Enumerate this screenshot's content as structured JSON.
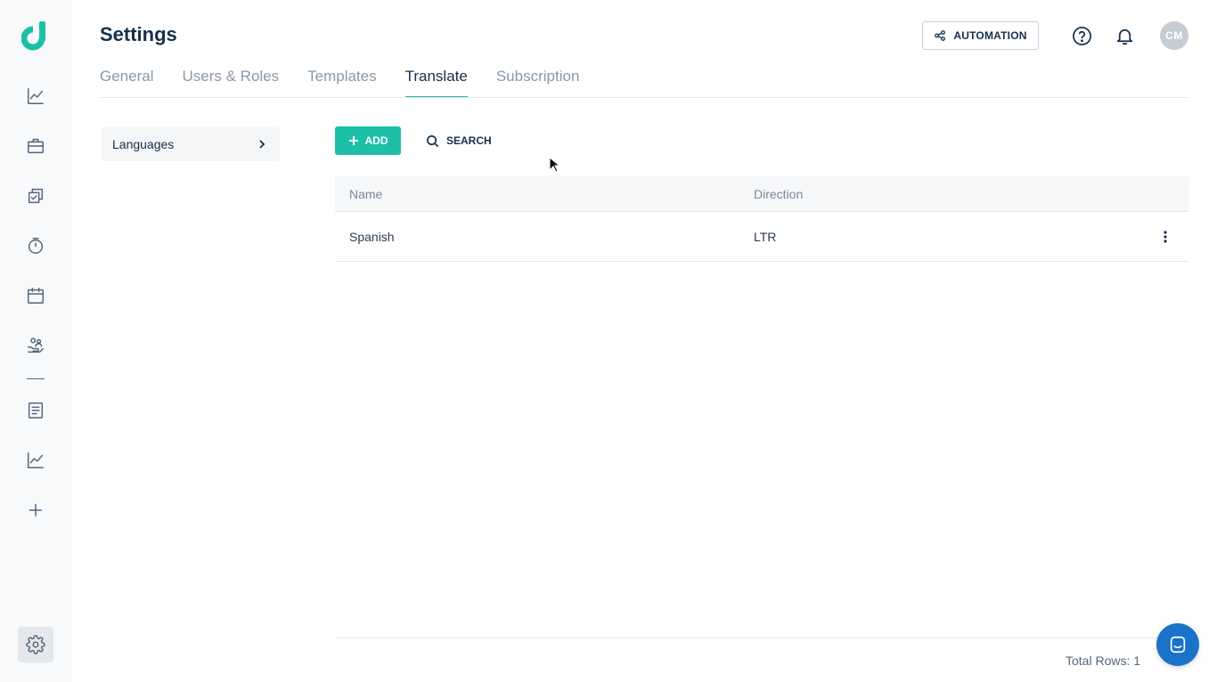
{
  "page": {
    "title": "Settings"
  },
  "header": {
    "automation_label": "AUTOMATION",
    "avatar_initials": "CM"
  },
  "tabs": [
    {
      "label": "General",
      "active": false
    },
    {
      "label": "Users & Roles",
      "active": false
    },
    {
      "label": "Templates",
      "active": false
    },
    {
      "label": "Translate",
      "active": true
    },
    {
      "label": "Subscription",
      "active": false
    }
  ],
  "subnav": {
    "items": [
      {
        "label": "Languages"
      }
    ]
  },
  "toolbar": {
    "add_label": "ADD",
    "search_label": "SEARCH"
  },
  "table": {
    "columns": [
      "Name",
      "Direction"
    ],
    "rows": [
      {
        "name": "Spanish",
        "direction": "LTR"
      }
    ]
  },
  "footer": {
    "total_rows": "Total Rows: 1"
  },
  "sidebar": {
    "icons": [
      "logo-icon",
      "dashboard-chart-icon",
      "briefcase-icon",
      "tasks-checklist-icon",
      "timer-icon",
      "calendar-icon",
      "clients-icon",
      "document-icon",
      "reports-chart-icon",
      "add-icon",
      "settings-gear-icon"
    ]
  },
  "colors": {
    "accent": "#1dbfa7",
    "sidebar_bg": "#f8f9fb",
    "chat": "#1a73c8",
    "text_dark": "#15304a"
  }
}
